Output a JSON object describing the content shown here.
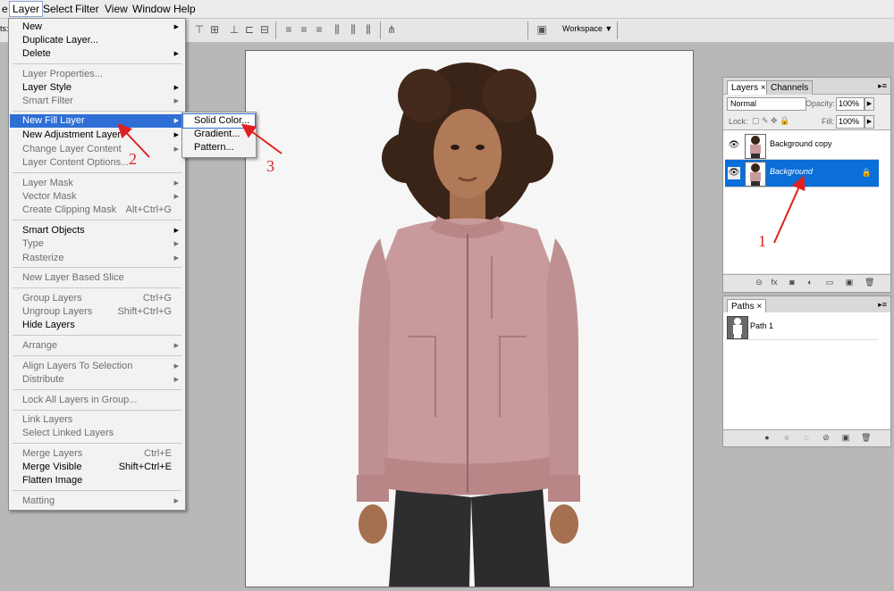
{
  "menubar": {
    "items": [
      {
        "label": "e",
        "left": 0
      },
      {
        "label": "Layer"
      },
      {
        "label": "Select"
      },
      {
        "label": "Filter"
      },
      {
        "label": "View"
      },
      {
        "label": "Window"
      },
      {
        "label": "Help"
      }
    ]
  },
  "options_bar": {
    "workspace_label": "Workspace ▼",
    "left_label": "ts:"
  },
  "layer_menu": {
    "new": "New",
    "duplicate": "Duplicate Layer...",
    "delete": "Delete",
    "layer_properties": "Layer Properties...",
    "layer_style": "Layer Style",
    "smart_filter": "Smart Filter",
    "new_fill_layer": "New Fill Layer",
    "new_adjustment_layer": "New Adjustment Layer",
    "change_layer_content": "Change Layer Content",
    "layer_content_options": "Layer Content Options...",
    "layer_mask": "Layer Mask",
    "vector_mask": "Vector Mask",
    "create_clipping_mask": "Create Clipping Mask",
    "create_clipping_mask_sc": "Alt+Ctrl+G",
    "smart_objects": "Smart Objects",
    "type": "Type",
    "rasterize": "Rasterize",
    "new_layer_based_slice": "New Layer Based Slice",
    "group_layers": "Group Layers",
    "group_layers_sc": "Ctrl+G",
    "ungroup_layers": "Ungroup Layers",
    "ungroup_layers_sc": "Shift+Ctrl+G",
    "hide_layers": "Hide Layers",
    "arrange": "Arrange",
    "align_layers": "Align Layers To Selection",
    "distribute": "Distribute",
    "lock_all": "Lock All Layers in Group...",
    "link_layers": "Link Layers",
    "select_linked": "Select Linked Layers",
    "merge_layers": "Merge Layers",
    "merge_layers_sc": "Ctrl+E",
    "merge_visible": "Merge Visible",
    "merge_visible_sc": "Shift+Ctrl+E",
    "flatten_image": "Flatten Image",
    "matting": "Matting"
  },
  "fill_submenu": {
    "solid_color": "Solid Color...",
    "gradient": "Gradient...",
    "pattern": "Pattern..."
  },
  "layers_panel": {
    "tab_layers": "Layers ×",
    "tab_channels": "Channels",
    "blend_mode": "Normal",
    "opacity_label": "Opacity:",
    "opacity_value": "100%",
    "lock_label": "Lock:",
    "fill_label": "Fill:",
    "fill_value": "100%",
    "layers": [
      {
        "name": "Background copy",
        "selected": false
      },
      {
        "name": "Background",
        "selected": true
      }
    ]
  },
  "paths_panel": {
    "tab_paths": "Paths ×",
    "paths": [
      {
        "name": "Path 1"
      }
    ]
  },
  "annotations": {
    "one": "1",
    "two": "2",
    "three": "3"
  },
  "colors": {
    "highlight": "#2f6fd5",
    "layer_selected": "#0a6fd8",
    "annotation": "#e02020",
    "jacket": "#c89a9c",
    "hair": "#3a2418",
    "pants": "#2e2e30"
  }
}
